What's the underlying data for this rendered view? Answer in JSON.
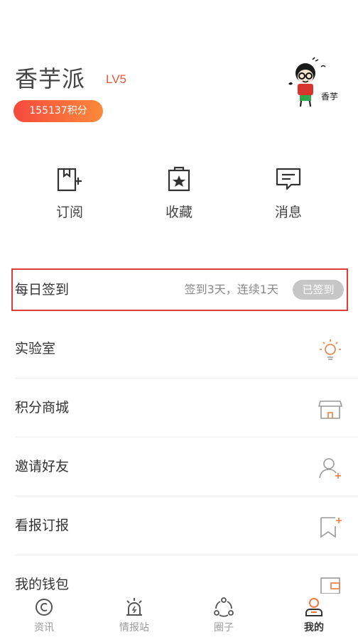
{
  "profile": {
    "username": "香芋派",
    "level": "LV5",
    "points_badge": "155137积分",
    "avatar_caption": "香芋"
  },
  "quick_actions": [
    {
      "label": "订阅",
      "icon": "subscribe-icon"
    },
    {
      "label": "收藏",
      "icon": "favorites-icon"
    },
    {
      "label": "消息",
      "icon": "message-icon"
    }
  ],
  "daily_signin": {
    "label": "每日签到",
    "info": "签到3天，连续1天",
    "button": "已签到"
  },
  "menu": [
    {
      "label": "实验室",
      "icon": "lightbulb-icon"
    },
    {
      "label": "积分商城",
      "icon": "store-icon"
    },
    {
      "label": "邀请好友",
      "icon": "add-friend-icon"
    },
    {
      "label": "看报订报",
      "icon": "bookmark-add-icon"
    },
    {
      "label": "我的钱包",
      "icon": "wallet-icon"
    }
  ],
  "tabbar": [
    {
      "label": "资讯",
      "icon": "news-icon",
      "active": false
    },
    {
      "label": "情报站",
      "icon": "alarm-icon",
      "active": false
    },
    {
      "label": "圈子",
      "icon": "circle-icon",
      "active": false
    },
    {
      "label": "我的",
      "icon": "profile-icon",
      "active": true
    }
  ],
  "colors": {
    "accent": "#e8553b",
    "signin_border": "#e03c3c",
    "points_gradient_start": "#f5493e",
    "points_gradient_end": "#fb8a3a",
    "icon_orange": "#f07a3c"
  }
}
